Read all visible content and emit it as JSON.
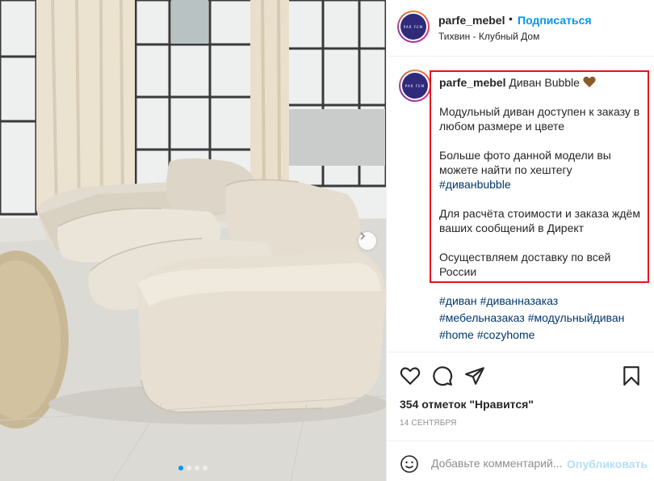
{
  "header": {
    "username": "parfe_mebel",
    "separator": "•",
    "follow_label": "Подписаться",
    "location": "Тихвин - Клубный Дом",
    "avatar_text": "PAR FEM"
  },
  "caption": {
    "username": "parfe_mebel",
    "title": "Диван Bubble",
    "line1a": "Модульный диван доступен к заказу в",
    "line1b": "любом размере и цвете",
    "line2a": "Больше фото данной модели вы",
    "line2b": "можете найти по хештегу",
    "hashtag_inline": "#диванbubble",
    "line3a": "Для расчёта стоимости и заказа ждём",
    "line3b": "ваших сообщений в Директ",
    "line4a": "Осуществляем доставку по всей",
    "line4b": "России",
    "highlight_color": "#e8121b"
  },
  "hashtags": [
    "#диван",
    "#диванназаказ",
    "#мебельназаказ",
    "#модульныйдиван",
    "#home",
    "#cozyhome"
  ],
  "actions": {
    "icons": [
      "heart-outline-icon",
      "comment-icon",
      "share-icon",
      "bookmark-icon"
    ]
  },
  "likes_text": "354 отметок \"Нравится\"",
  "date_text": "14 сентября",
  "comment": {
    "placeholder": "Добавьте комментарий...",
    "publish_label": "Опубликовать"
  },
  "carousel": {
    "total_slides": 4,
    "active_slide": 1
  },
  "colors": {
    "accent": "#0095f6",
    "link": "#00376b",
    "muted": "#8e8e8e",
    "publish_disabled": "#b2dffc"
  }
}
